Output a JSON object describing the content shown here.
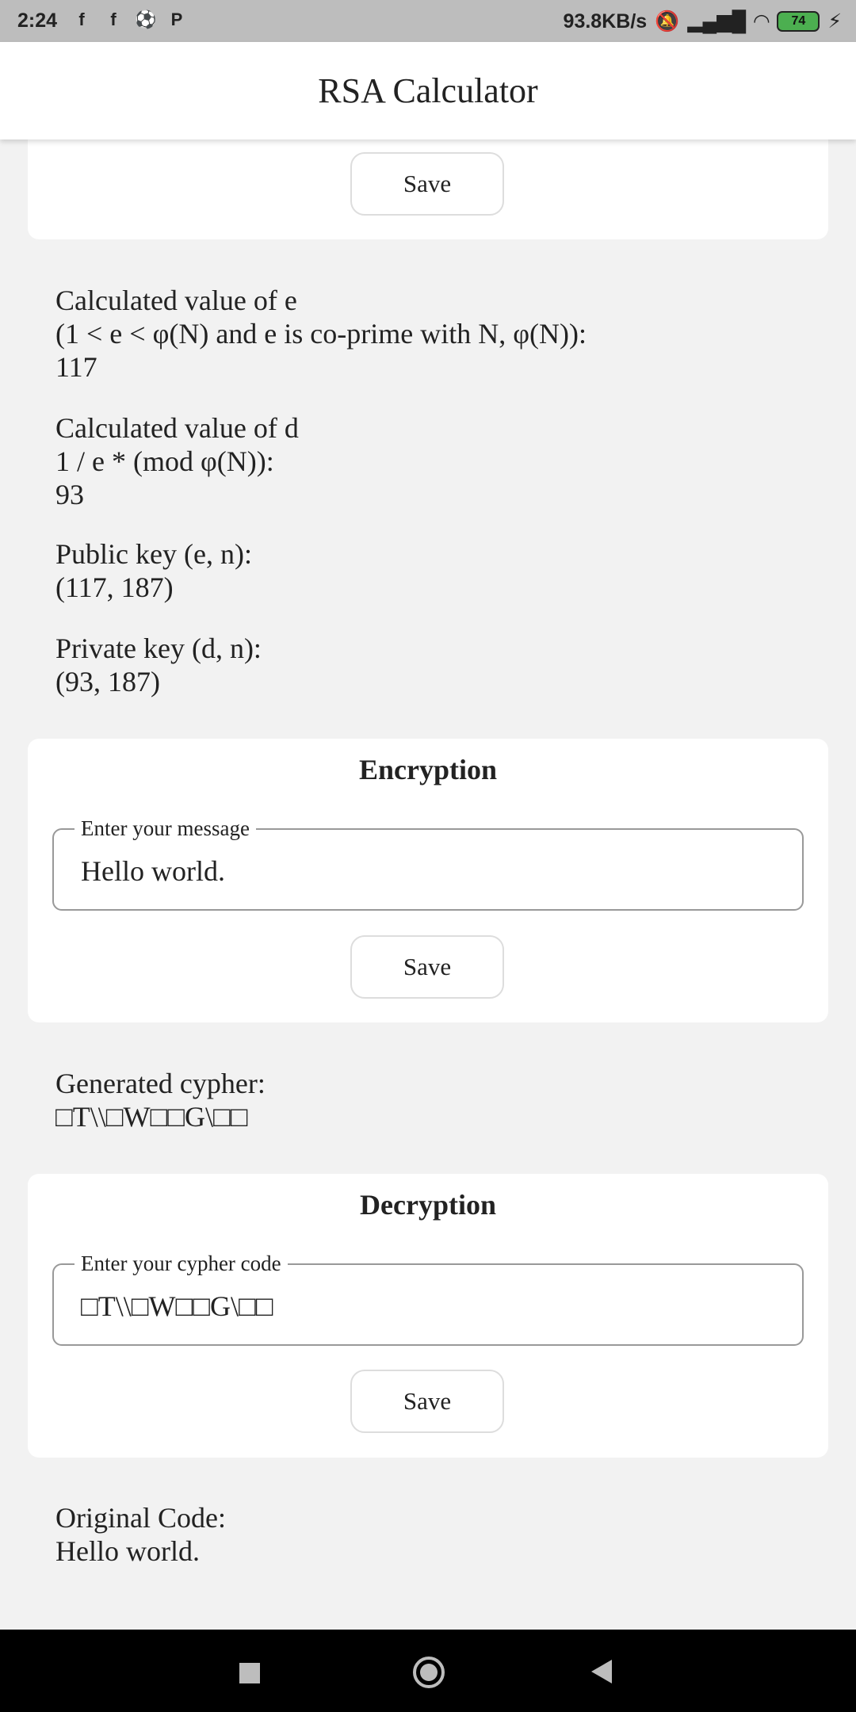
{
  "status_bar": {
    "time": "2:24",
    "network_speed": "93.8KB/s",
    "battery": "74",
    "icons": [
      "facebook-icon",
      "facebook-icon",
      "soccer-ball-icon",
      "p-icon",
      "mute-icon",
      "signal-icon",
      "wifi-icon",
      "battery-icon",
      "charging-icon"
    ]
  },
  "app_bar": {
    "title": "RSA Calculator"
  },
  "top_card": {
    "save_label": "Save"
  },
  "results": {
    "e_label": "Calculated value of e",
    "e_condition": "(1 < e < φ(N) and e is co-prime with N, φ(N)):",
    "e_value": "117",
    "d_label": "Calculated value of d",
    "d_formula": "1 / e * (mod φ(N)):",
    "d_value": "93",
    "public_key_label": "Public key (e, n):",
    "public_key_value": "(117, 187)",
    "private_key_label": "Private key (d, n):",
    "private_key_value": "(93, 187)"
  },
  "encryption": {
    "title": "Encryption",
    "field_label": "Enter your message",
    "field_value": "Hello world.",
    "save_label": "Save"
  },
  "cypher_output": {
    "label": "Generated cypher:",
    "value": "□T\\\\□W□□G\\□□"
  },
  "decryption": {
    "title": "Decryption",
    "field_label": "Enter your cypher code",
    "field_value": "□T\\\\□W□□G\\□□",
    "save_label": "Save"
  },
  "original_output": {
    "label": "Original Code:",
    "value": "Hello world."
  },
  "nav_bar": {
    "icons": [
      "recents-square-icon",
      "home-circle-icon",
      "back-triangle-icon"
    ]
  }
}
